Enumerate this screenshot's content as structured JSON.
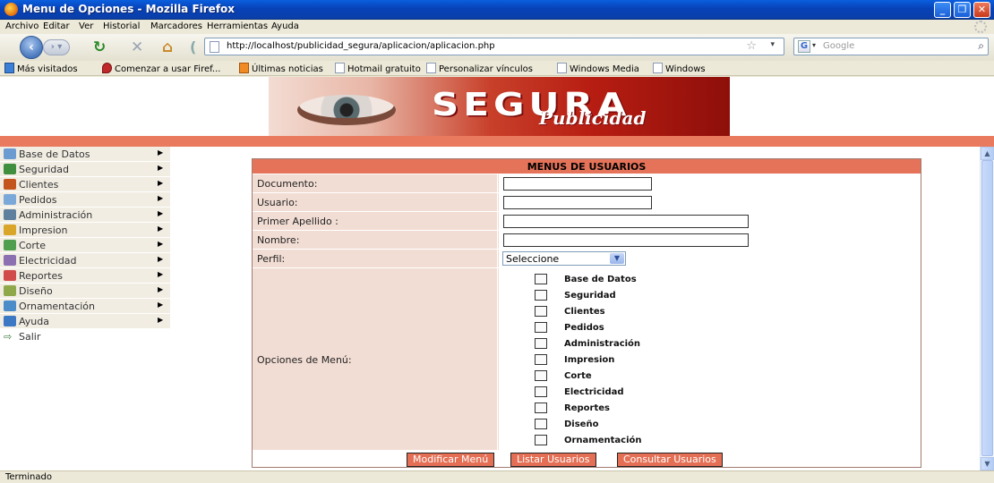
{
  "window": {
    "title": "Menu de Opciones - Mozilla Firefox"
  },
  "menubar": [
    "Archivo",
    "Editar",
    "Ver",
    "Historial",
    "Marcadores",
    "Herramientas",
    "Ayuda"
  ],
  "nav": {
    "url": "http://localhost/publicidad_segura/aplicacion/aplicacion.php",
    "search_placeholder": "Google"
  },
  "bookmarks": [
    "Más visitados",
    "Comenzar a usar Firef...",
    "Últimas noticias",
    "Hotmail gratuito",
    "Personalizar vínculos",
    "Windows Media",
    "Windows"
  ],
  "banner": {
    "brand": "SEGURA",
    "sub": "Publicidad"
  },
  "sidebar": {
    "items": [
      {
        "label": "Base de Datos",
        "color": "#6b9bd1"
      },
      {
        "label": "Seguridad",
        "color": "#3f8f3f"
      },
      {
        "label": "Clientes",
        "color": "#c4541d"
      },
      {
        "label": "Pedidos",
        "color": "#7aa9d9"
      },
      {
        "label": "Administración",
        "color": "#5e7f9e"
      },
      {
        "label": "Impresion",
        "color": "#d9a62a"
      },
      {
        "label": "Corte",
        "color": "#4f9f4f"
      },
      {
        "label": "Electricidad",
        "color": "#8c6fb0"
      },
      {
        "label": "Reportes",
        "color": "#d14b4b"
      },
      {
        "label": "Diseño",
        "color": "#8fa84a"
      },
      {
        "label": "Ornamentación",
        "color": "#4b8cc9"
      },
      {
        "label": "Ayuda",
        "color": "#3c78c4"
      }
    ],
    "exit": "Salir"
  },
  "form": {
    "title": "MENUS DE USUARIOS",
    "fields": {
      "documento": "Documento:",
      "usuario": "Usuario:",
      "apellido": "Primer Apellido :",
      "nombre": "Nombre:",
      "perfil": "Perfil:"
    },
    "perfil_value": "Seleccione",
    "options_label": "Opciones de Menú:",
    "options": [
      "Base de Datos",
      "Seguridad",
      "Clientes",
      "Pedidos",
      "Administración",
      "Impresion",
      "Corte",
      "Electricidad",
      "Reportes",
      "Diseño",
      "Ornamentación"
    ],
    "buttons": {
      "modify": "Modificar Menú",
      "list": "Listar Usuarios",
      "consult": "Consultar Usuarios"
    }
  },
  "status": "Terminado"
}
